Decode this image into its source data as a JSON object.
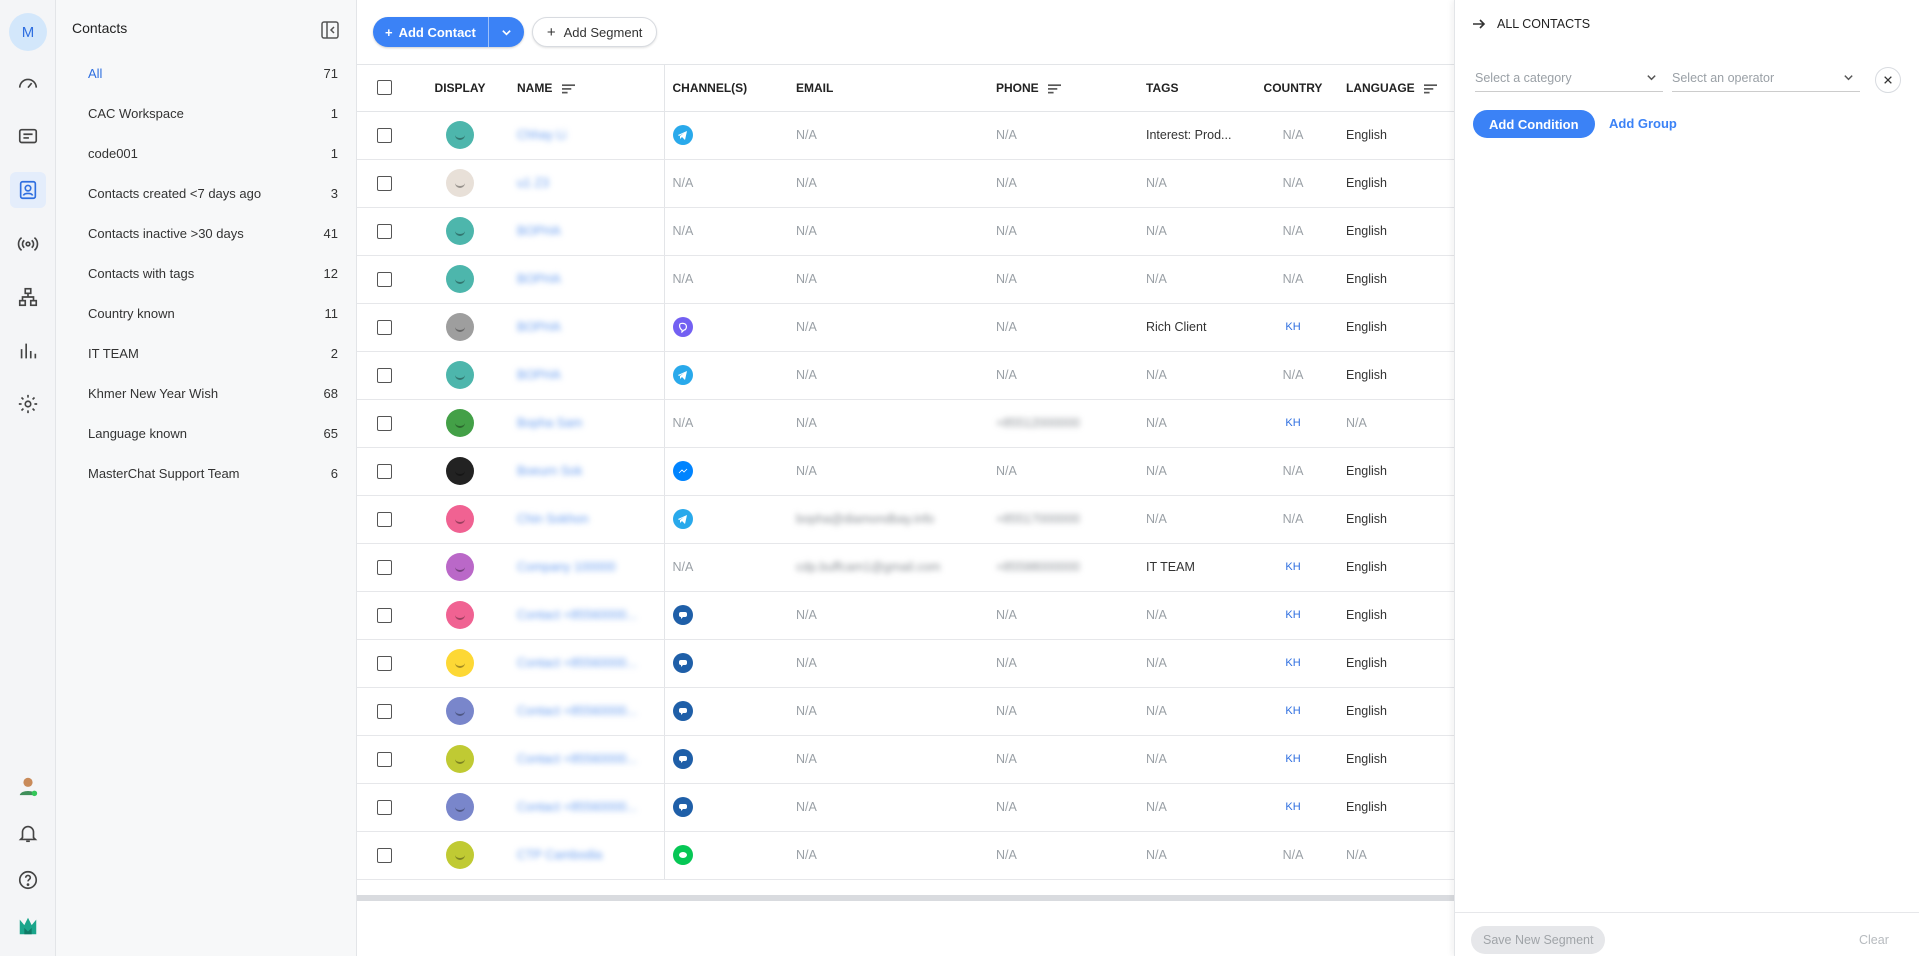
{
  "rail": {
    "avatar_initial": "M",
    "icons": [
      "dashboard-icon",
      "messages-icon",
      "contacts-icon",
      "broadcast-icon",
      "workflow-icon",
      "reports-icon",
      "settings-icon"
    ],
    "bottom_icons": [
      "user-avatar-icon",
      "bell-icon",
      "help-icon",
      "brand-logo-icon"
    ]
  },
  "segments": {
    "title": "Contacts",
    "items": [
      {
        "label": "All",
        "count": "71",
        "active": true
      },
      {
        "label": "CAC Workspace",
        "count": "1"
      },
      {
        "label": "code001",
        "count": "1"
      },
      {
        "label": "Contacts created <7 days ago",
        "count": "3"
      },
      {
        "label": "Contacts inactive >30 days",
        "count": "41"
      },
      {
        "label": "Contacts with tags",
        "count": "12"
      },
      {
        "label": "Country known",
        "count": "11"
      },
      {
        "label": "IT TEAM",
        "count": "2"
      },
      {
        "label": "Khmer New Year Wish",
        "count": "68"
      },
      {
        "label": "Language known",
        "count": "65"
      },
      {
        "label": "MasterChat Support Team",
        "count": "6"
      }
    ]
  },
  "toolbar": {
    "add_contact_label": "Add Contact",
    "add_segment_label": "Add Segment"
  },
  "table": {
    "headers": {
      "display": "DISPLAY",
      "name": "NAME",
      "channels": "CHANNEL(S)",
      "email": "EMAIL",
      "phone": "PHONE",
      "tags": "TAGS",
      "country": "COUNTRY",
      "language": "LANGUAGE"
    },
    "rows": [
      {
        "avatar_color": "#4db6ac",
        "name": "Chhay Li",
        "channel": "telegram",
        "email": "N/A",
        "phone": "N/A",
        "tags": "Interest: Prod...",
        "country": "N/A",
        "language": "English"
      },
      {
        "avatar_color": "#e8e0d8",
        "name": "u1 Z3",
        "channel": "",
        "email": "N/A",
        "phone": "N/A",
        "tags": "N/A",
        "country": "N/A",
        "language": "English"
      },
      {
        "avatar_color": "#4db6ac",
        "name": "BOPHA",
        "channel": "",
        "email": "N/A",
        "phone": "N/A",
        "tags": "N/A",
        "country": "N/A",
        "language": "English"
      },
      {
        "avatar_color": "#4db6ac",
        "name": "BOPHA",
        "channel": "",
        "email": "N/A",
        "phone": "N/A",
        "tags": "N/A",
        "country": "N/A",
        "language": "English"
      },
      {
        "avatar_color": "#9e9e9e",
        "name": "BOPHA",
        "channel": "viber",
        "email": "N/A",
        "phone": "N/A",
        "tags": "Rich Client",
        "country": "KH",
        "language": "English"
      },
      {
        "avatar_color": "#4db6ac",
        "name": "BOPHA",
        "channel": "telegram",
        "email": "N/A",
        "phone": "N/A",
        "tags": "N/A",
        "country": "N/A",
        "language": "English"
      },
      {
        "avatar_color": "#43a047",
        "name": "Bopha Sam",
        "channel": "",
        "email": "N/A",
        "phone": "+85512000000",
        "tags": "N/A",
        "country": "KH",
        "language": "N/A"
      },
      {
        "avatar_color": "#222222",
        "name": "Boeurn Sok",
        "channel": "messenger",
        "email": "N/A",
        "phone": "N/A",
        "tags": "N/A",
        "country": "N/A",
        "language": "English"
      },
      {
        "avatar_color": "#f06292",
        "name": "Chin Sokhon",
        "channel": "telegram",
        "email": "bopha@diamondbay.info",
        "phone": "+85517000000",
        "tags": "N/A",
        "country": "N/A",
        "language": "English"
      },
      {
        "avatar_color": "#ba68c8",
        "name": "Company 100000",
        "channel": "",
        "email": "cdp.buffcam1@gmail.com",
        "phone": "+85598000000",
        "tags": "IT TEAM",
        "country": "KH",
        "language": "English"
      },
      {
        "avatar_color": "#f06292",
        "name": "Contact +85560000...",
        "channel": "chat",
        "email": "N/A",
        "phone": "N/A",
        "tags": "N/A",
        "country": "KH",
        "language": "English"
      },
      {
        "avatar_color": "#fdd835",
        "name": "Contact +85560000...",
        "channel": "chat",
        "email": "N/A",
        "phone": "N/A",
        "tags": "N/A",
        "country": "KH",
        "language": "English"
      },
      {
        "avatar_color": "#7986cb",
        "name": "Contact +85560000...",
        "channel": "chat",
        "email": "N/A",
        "phone": "N/A",
        "tags": "N/A",
        "country": "KH",
        "language": "English"
      },
      {
        "avatar_color": "#c0ca33",
        "name": "Contact +85560000...",
        "channel": "chat",
        "email": "N/A",
        "phone": "N/A",
        "tags": "N/A",
        "country": "KH",
        "language": "English"
      },
      {
        "avatar_color": "#7986cb",
        "name": "Contact +85560000...",
        "channel": "chat",
        "email": "N/A",
        "phone": "N/A",
        "tags": "N/A",
        "country": "KH",
        "language": "English"
      },
      {
        "avatar_color": "#c0ca33",
        "name": "CTP Cambodia",
        "channel": "line",
        "email": "N/A",
        "phone": "N/A",
        "tags": "N/A",
        "country": "N/A",
        "language": "N/A"
      }
    ]
  },
  "panel": {
    "title": "ALL CONTACTS",
    "category_placeholder": "Select a category",
    "operator_placeholder": "Select an operator",
    "add_condition_label": "Add Condition",
    "add_group_label": "Add Group",
    "save_label": "Save New Segment",
    "clear_label": "Clear"
  },
  "colors": {
    "accent": "#3b82f6",
    "telegram": "#29a9eb",
    "viber": "#7360f2",
    "messenger": "#0084ff",
    "chat": "#1f5fa8",
    "line": "#06c755"
  }
}
